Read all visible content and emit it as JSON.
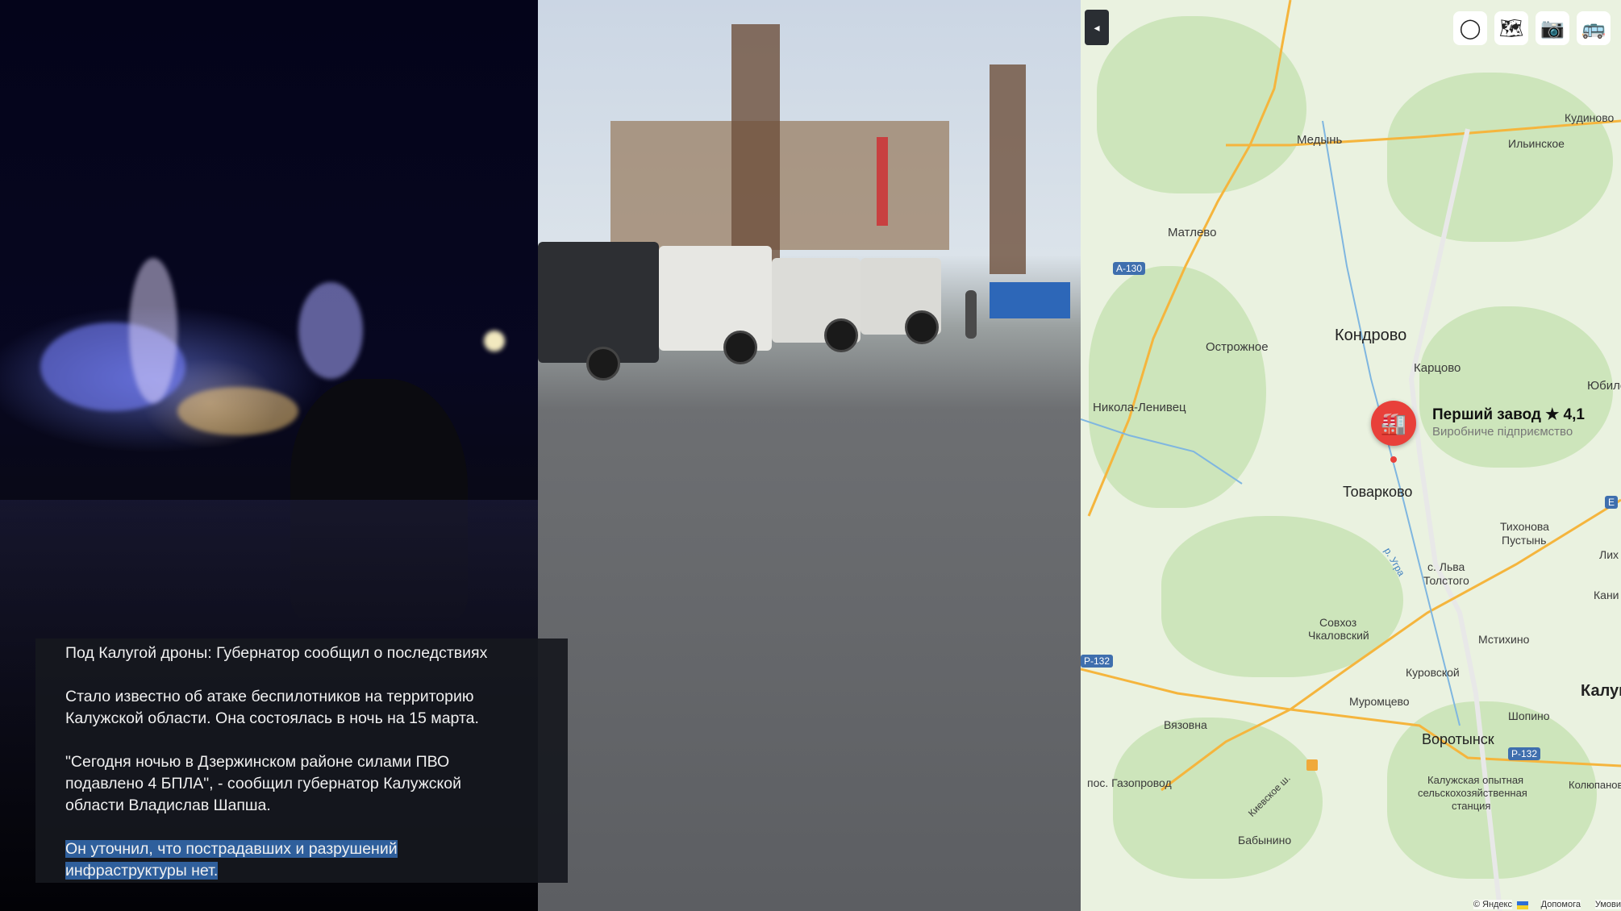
{
  "news": {
    "headline": "Под Калугой дроны: Губернатор сообщил о последствиях",
    "para1_line1": "Стало известно об атаке беспилотников на территорию",
    "para1_line2": "Калужской области. Она состоялась в ночь на 15 марта.",
    "para2_line1": "\"Сегодня ночью в Дзержинском районе силами ПВО",
    "para2_line2": "подавлено 4  БПЛА\", - сообщил губернатор Калужской",
    "para2_line3": "области Владислав Шапша.",
    "para3_line1": "Он уточнил, что пострадавших и разрушений",
    "para3_line2": "инфраструктуры нет."
  },
  "map": {
    "collapse_glyph": "◂",
    "controls": [
      {
        "icon": "layers-circle-icon",
        "glyph": "◯"
      },
      {
        "icon": "map-mode-icon",
        "glyph": "🗺"
      },
      {
        "icon": "panorama-icon",
        "glyph": "📷"
      },
      {
        "icon": "transport-icon",
        "glyph": "🚌"
      }
    ],
    "towns": {
      "medyn": "Медынь",
      "kudinovo": "Кудиново",
      "ilinskoe": "Ильинское",
      "matlevo": "Матлево",
      "ostrozhnoe": "Острожное",
      "kondrovo": "Кондрово",
      "kartsovo": "Карцово",
      "yuhnovets": "Юбиле",
      "nikola_lenivets": "Никола-Ленивец",
      "tovarkovo": "Товарково",
      "tikhonova_1": "Тихонова",
      "tikhonova_2": "Пустынь",
      "lvatolstogo_1": "с. Льва",
      "lvatolstogo_2": "Толстого",
      "lih": "Лих",
      "kani": "Кани",
      "sovkhoz_1": "Совхоз",
      "sovkhoz_2": "Чкаловский",
      "mstikhino": "Мстихино",
      "kurovskoy": "Куровской",
      "kaluga": "Калуг",
      "muromtsevo": "Муромцево",
      "vyazovna": "Вязовна",
      "shopino": "Шопино",
      "vorotynsk": "Воротынск",
      "gazoprovod": "пос. Газопровод",
      "kaluzhskaya_1": "Калужская опытная",
      "kaluzhskaya_2": "сельскохозяйственная",
      "kaluzhskaya_3": "станция",
      "kolyupanovo": "Колюпаново",
      "babynino": "Бабынино",
      "river_ugra": "р. Угра",
      "kievskoe": "Киевское ш."
    },
    "roads": {
      "a130": "А-130",
      "r132_left": "Р-132",
      "r132_right": "Р-132",
      "e": "Е"
    },
    "place": {
      "name": "Перший завод ★ 4,1",
      "category": "Виробниче підприємство",
      "icon": "factory-icon"
    },
    "copyright_left": "© Яндекс",
    "copyright_mid": "Допомога",
    "copyright_right": "Умови"
  }
}
